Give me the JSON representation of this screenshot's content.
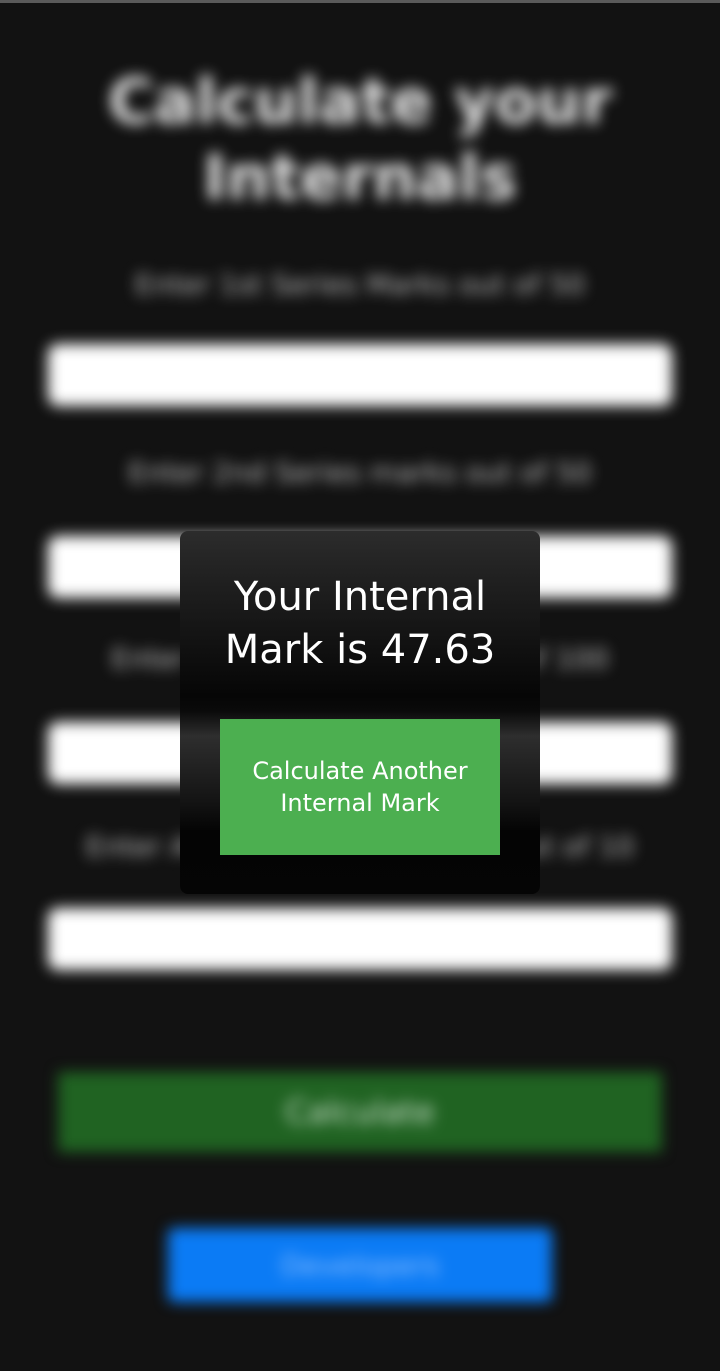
{
  "background": {
    "title": "Calculate your Internals",
    "fields": [
      {
        "label": "Enter 1st Series Marks out of 50",
        "value": ""
      },
      {
        "label": "Enter 2nd Series marks out of 50",
        "value": ""
      },
      {
        "label": "Enter Assignment marks out of 100",
        "value": ""
      },
      {
        "label": "Enter Attendance percentage out of 10",
        "value": ""
      }
    ],
    "calculate_label": "Calculate",
    "developers_label": "Developers"
  },
  "dialog": {
    "message": "Your Internal Mark is 47.63",
    "button_label": "Calculate Another Internal Mark"
  },
  "colors": {
    "background": "#121212",
    "calculate_button": "#206322",
    "developers_button": "#0b7bf5",
    "dialog_button": "#4caf50"
  }
}
